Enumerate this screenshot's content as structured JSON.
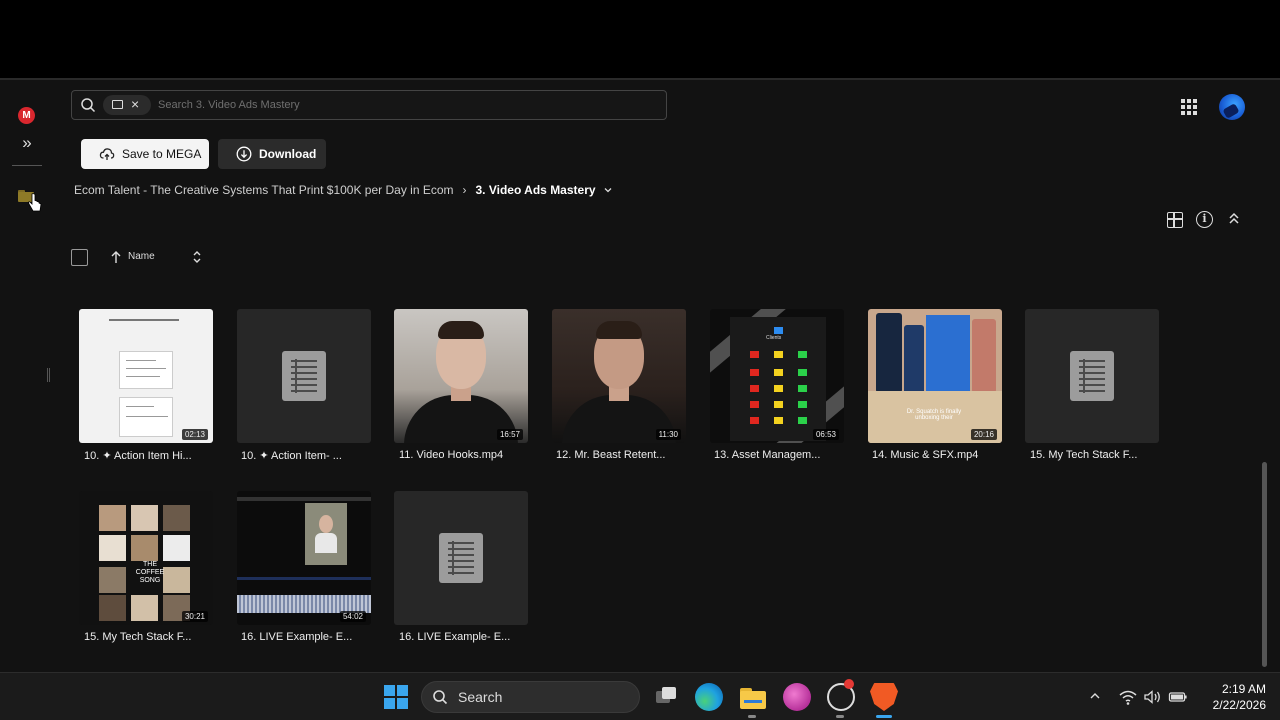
{
  "search": {
    "placeholder": "Search 3. Video Ads Mastery"
  },
  "actions": {
    "save_label": "Save to MEGA",
    "download_label": "Download"
  },
  "breadcrumb": {
    "parent": "Ecom Talent - The Creative Systems That Print $100K per Day in Ecom",
    "current": "3. Video Ads Mastery"
  },
  "list_header": {
    "name_label": "Name"
  },
  "files": [
    {
      "name": "10. ✦ Action Item Hi...",
      "duration": "02:13",
      "thumb": "sheet"
    },
    {
      "name": "10. ✦ Action Item- ...",
      "duration": "",
      "thumb": "doc"
    },
    {
      "name": "11. Video Hooks.mp4",
      "duration": "16:57",
      "thumb": "face-light"
    },
    {
      "name": "12. Mr. Beast Retent...",
      "duration": "11:30",
      "thumb": "face-dark"
    },
    {
      "name": "13. Asset Managem...",
      "duration": "06:53",
      "thumb": "diagram"
    },
    {
      "name": "14. Music & SFX.mp4",
      "duration": "20:16",
      "thumb": "product"
    },
    {
      "name": "15. My Tech Stack F...",
      "duration": "",
      "thumb": "doc"
    },
    {
      "name": "15. My Tech Stack F...",
      "duration": "30:21",
      "thumb": "collage"
    },
    {
      "name": "16. LIVE Example- E...",
      "duration": "54:02",
      "thumb": "editor"
    },
    {
      "name": "16. LIVE Example- E...",
      "duration": "",
      "thumb": "doc"
    }
  ],
  "thumb_text": {
    "diagram_title": "Clients",
    "product_caption": "Dr. Squatch is finally unboxing their",
    "collage_caption": "THE COFFEE SONG"
  },
  "taskbar": {
    "search_label": "Search",
    "time": "2:19 AM",
    "date": "2/22/2026"
  },
  "icons": {
    "logo": "mega-logo",
    "rail": [
      "expand-icon",
      "folder-icon"
    ],
    "header": [
      "apps-grid-icon",
      "avatar"
    ],
    "view": [
      "grid-view-icon",
      "info-icon",
      "collapse-icon"
    ]
  },
  "colors": {
    "brand_red": "#d9272e",
    "accent_blue": "#3aa6ee",
    "background": "#121212"
  }
}
